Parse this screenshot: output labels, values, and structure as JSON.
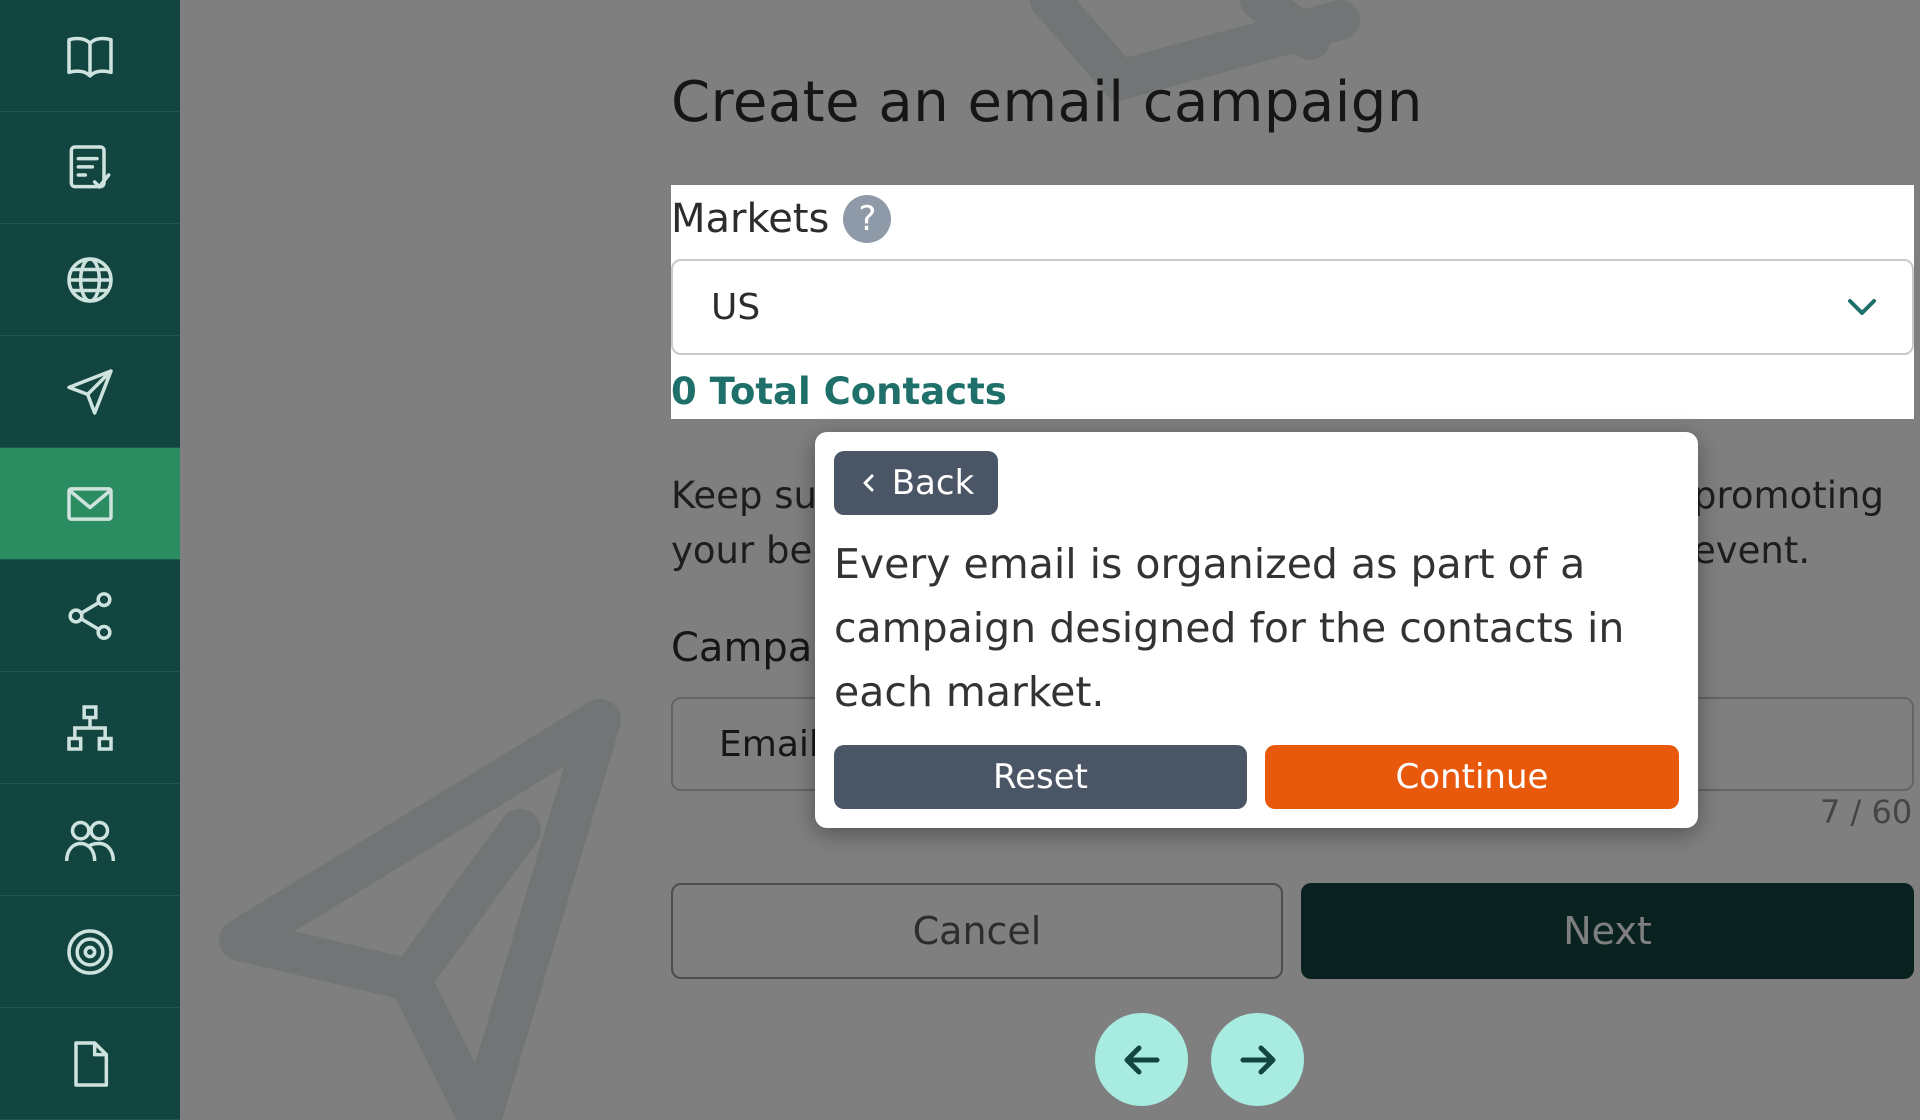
{
  "sidebar": {
    "items": [
      {
        "icon": "book-icon",
        "active": false
      },
      {
        "icon": "checklist-icon",
        "active": false
      },
      {
        "icon": "globe-icon",
        "active": false
      },
      {
        "icon": "send-icon",
        "active": false
      },
      {
        "icon": "mail-icon",
        "active": true
      },
      {
        "icon": "share-icon",
        "active": false
      },
      {
        "icon": "sitemap-icon",
        "active": false
      },
      {
        "icon": "users-icon",
        "active": false
      },
      {
        "icon": "target-icon",
        "active": false
      },
      {
        "icon": "document-icon",
        "active": false
      }
    ]
  },
  "page": {
    "title": "Create an email campaign"
  },
  "markets": {
    "label": "Markets",
    "help_glyph": "?",
    "selected": "US",
    "total_contacts": "0 Total Contacts"
  },
  "description": {
    "line1_start": "Keep su",
    "line1_end": "promoting",
    "line2_start": "your be",
    "line2_end": "event."
  },
  "campaign": {
    "label_partial": "Campa",
    "input_value_partial": "Email",
    "char_count": "7 / 60"
  },
  "actions": {
    "cancel_label": "Cancel",
    "next_label": "Next"
  },
  "tour": {
    "back_label": "Back",
    "message": "Every email is organized as part of a campaign designed for the contacts in each market.",
    "reset_label": "Reset",
    "continue_label": "Continue"
  },
  "colors": {
    "sidebar_bg": "#134540",
    "sidebar_active": "#2b8c62",
    "accent_teal": "#1f6f6a",
    "continue_orange": "#e8590c",
    "nav_circle": "#a8ebe0"
  }
}
